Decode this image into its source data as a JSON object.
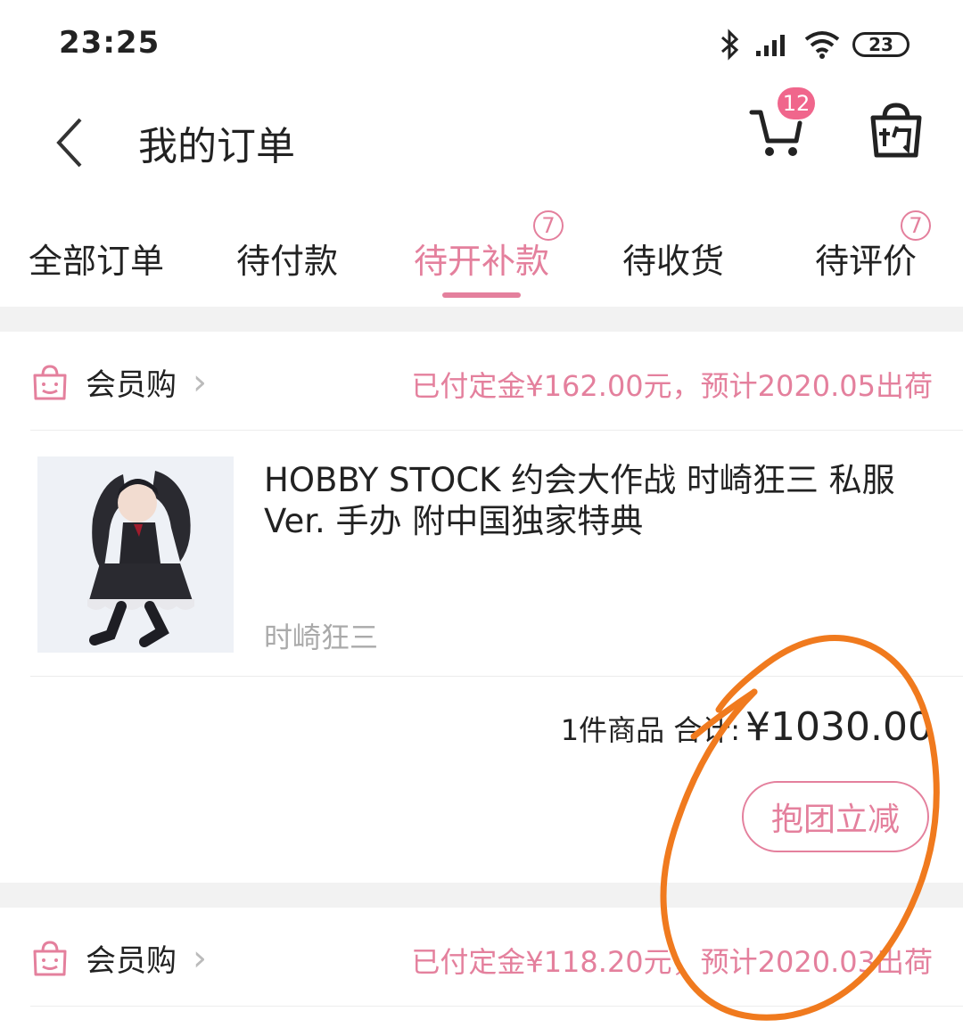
{
  "status_bar": {
    "time": "23:25",
    "battery": "23"
  },
  "header": {
    "title": "我的订单",
    "cart_badge": "12"
  },
  "tabs": [
    {
      "label": "全部订单",
      "badge": ""
    },
    {
      "label": "待付款",
      "badge": ""
    },
    {
      "label": "待开补款",
      "badge": "7"
    },
    {
      "label": "待收货",
      "badge": ""
    },
    {
      "label": "待评价",
      "badge": "7"
    }
  ],
  "orders": [
    {
      "store": "会员购",
      "status": "已付定金¥162.00元，预计2020.05出荷",
      "product_title": "HOBBY STOCK 约会大作战 时崎狂三 私服 Ver. 手办 附中国独家特典",
      "product_spec": "时崎狂三",
      "count_label": "1件商品 合计:",
      "total": "¥1030.00",
      "action": "抱团立减"
    },
    {
      "store": "会员购",
      "status": "已付定金¥118.20元，预计2020.03出荷"
    }
  ],
  "colors": {
    "accent": "#e4809d",
    "annotation": "#f07a1e",
    "background_band": "#f2f2f2"
  }
}
